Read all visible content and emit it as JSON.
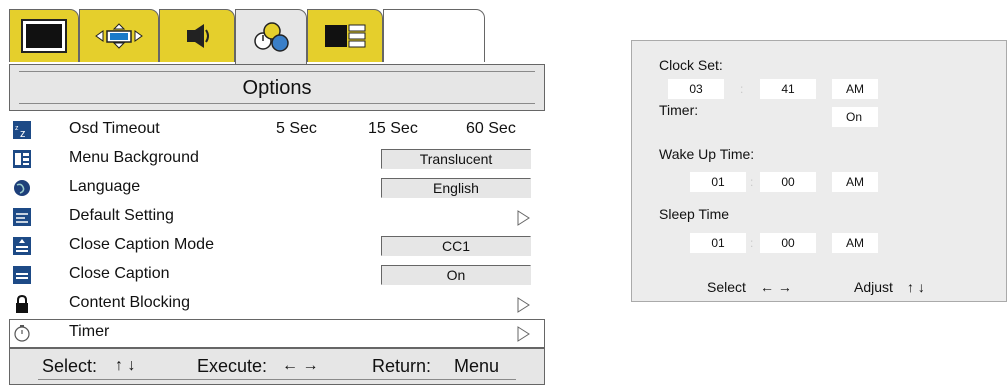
{
  "osd": {
    "title": "Options",
    "tabs": [
      {
        "icon": "picture-icon"
      },
      {
        "icon": "screen-position-icon"
      },
      {
        "icon": "audio-icon"
      },
      {
        "icon": "options-icon"
      },
      {
        "icon": "layout-icon"
      }
    ],
    "osd_timeout": {
      "label": "Osd Timeout",
      "options": [
        "5 Sec",
        "15 Sec",
        "60 Sec"
      ]
    },
    "menu_background": {
      "label": "Menu Background",
      "value": "Translucent"
    },
    "language": {
      "label": "Language",
      "value": "English"
    },
    "default_setting": {
      "label": "Default Setting"
    },
    "close_caption_mode": {
      "label": "Close Caption Mode",
      "value": "CC1"
    },
    "close_caption": {
      "label": "Close Caption",
      "value": "On"
    },
    "content_blocking": {
      "label": "Content Blocking"
    },
    "timer": {
      "label": "Timer"
    },
    "footer": {
      "select_label": "Select:",
      "select_keys": "↑ ↓",
      "execute_label": "Execute:",
      "execute_keys": "← →",
      "return_label": "Return:",
      "return_key": "Menu"
    }
  },
  "timer_panel": {
    "clock_set": {
      "label": "Clock Set:",
      "hour": "03",
      "minute": "41",
      "ampm": "AM"
    },
    "timer": {
      "label": "Timer:",
      "value": "On"
    },
    "wake_up": {
      "label": "Wake Up Time:",
      "hour": "01",
      "minute": "00",
      "ampm": "AM"
    },
    "sleep": {
      "label": "Sleep Time",
      "hour": "01",
      "minute": "00",
      "ampm": "AM"
    },
    "separator": ":",
    "help": {
      "select_label": "Select",
      "select_keys": "← →",
      "adjust_label": "Adjust",
      "adjust_keys": "↑ ↓"
    }
  },
  "colors": {
    "tab_active": "#e5cf2c",
    "panel_gray": "#e6e6e6",
    "timer_bg": "#ececec"
  }
}
